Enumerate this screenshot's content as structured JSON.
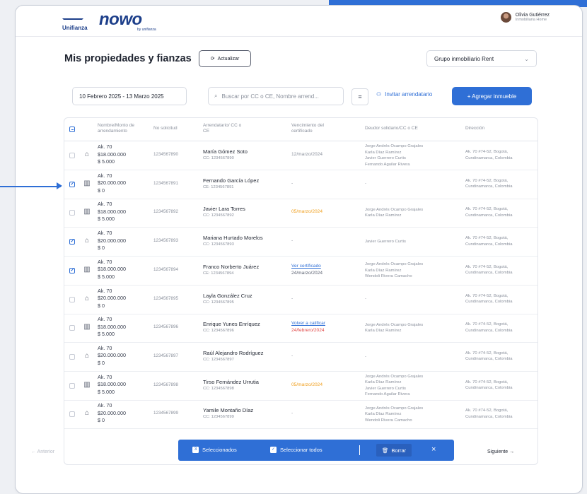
{
  "brand": {
    "partner": "Unifianza",
    "logo": "nowo",
    "logo_sub": "by unifianza"
  },
  "user": {
    "name": "Olivia Gutiérrez",
    "role": "Inmobiliaria Home"
  },
  "page_title": "Mis propiedades y fianzas",
  "refresh_label": "Actualizar",
  "group_select": {
    "value": "Grupo inmobiliario Rent"
  },
  "date_range": "10 Febrero 2025 - 13 Marzo 2025",
  "search": {
    "placeholder": "Buscar por CC o CE, Nombre arrend..."
  },
  "invite_label": "Invitar arrendatario",
  "add_label": "+ Agregar inmueble",
  "headers": {
    "property": "Nombre/Monto de arrendamiento",
    "request": "No solicitud",
    "tenant": "Arrendatario/ CC o CE",
    "cert": "Vencimiento del certificado",
    "debtor": "Deudor solidario/CC o CE",
    "address": "Dirección"
  },
  "rows": [
    {
      "checked": false,
      "icon": "house",
      "name": "Ak. 70",
      "amount": "$18.000.000",
      "extra": "$ 5.000",
      "request": "1234567890",
      "tenant": "María Gómez Soto",
      "cc": "CC: 1234567890",
      "cert1": "12/marzo/2024",
      "cert2": "",
      "certStyle": "plain",
      "debtors": [
        "Jorge Andrés Ocampo Grajales",
        "Karla Díaz Ramírez",
        "Javier Guerrero Curtis",
        "Fernando Aguilar Rivera"
      ],
      "address": [
        "Ak. 70 #74-52, Bogotá,",
        "Cundinamarca, Colombia"
      ]
    },
    {
      "checked": true,
      "icon": "building",
      "name": "Ak. 70",
      "amount": "$20.000.000",
      "extra": "$ 0",
      "request": "1234567891",
      "tenant": "Fernando García López",
      "cc": "CE: 1234567891",
      "cert1": "-",
      "cert2": "",
      "certStyle": "plain",
      "debtors": [
        "-"
      ],
      "address": [
        "Ak. 70 #74-52, Bogotá,",
        "Cundinamarca, Colombia"
      ]
    },
    {
      "checked": false,
      "icon": "building",
      "name": "Ak. 70",
      "amount": "$18.000.000",
      "extra": "$ 5.000",
      "request": "1234567892",
      "tenant": "Javier Lara Torres",
      "cc": "CC: 1234567892",
      "cert1": "05/marzo/2024",
      "cert2": "",
      "certStyle": "orange",
      "debtors": [
        "Jorge Andrés Ocampo Grajales",
        "Karla Díaz Ramírez"
      ],
      "address": [
        "Ak. 70 #74-52, Bogotá,",
        "Cundinamarca, Colombia"
      ]
    },
    {
      "checked": true,
      "icon": "house",
      "name": "Ak. 70",
      "amount": "$20.000.000",
      "extra": "$ 0",
      "request": "1234567893",
      "tenant": "Mariana Hurtado Morelos",
      "cc": "CC: 1234567893",
      "cert1": "-",
      "cert2": "",
      "certStyle": "plain",
      "debtors": [
        "Javier Guerrero Curtis"
      ],
      "address": [
        "Ak. 70 #74-52, Bogotá,",
        "Cundinamarca, Colombia"
      ]
    },
    {
      "checked": true,
      "icon": "building",
      "name": "Ak. 70",
      "amount": "$18.000.000",
      "extra": "$ 5.000",
      "request": "1234567894",
      "tenant": "Franco Norberto Juárez",
      "cc": "CE: 1234567894",
      "cert1": "Ver certificado",
      "cert2": "24/marzo/2024",
      "certStyle": "link-dark",
      "debtors": [
        "Jorge Andrés Ocampo Grajales",
        "Karla Díaz Ramírez",
        "Wendoli Rivera Camacho"
      ],
      "address": [
        "Ak. 70 #74-52, Bogotá,",
        "Cundinamarca, Colombia"
      ]
    },
    {
      "checked": false,
      "icon": "house",
      "name": "Ak. 70",
      "amount": "$20.000.000",
      "extra": "$ 0",
      "request": "1234567895",
      "tenant": "Layla González Cruz",
      "cc": "CC: 1234567895",
      "cert1": "-",
      "cert2": "",
      "certStyle": "plain",
      "debtors": [
        "-"
      ],
      "address": [
        "Ak. 70 #74-52, Bogotá,",
        "Cundinamarca, Colombia"
      ]
    },
    {
      "checked": false,
      "icon": "building",
      "name": "Ak. 70",
      "amount": "$18.000.000",
      "extra": "$ 5.000",
      "request": "1234567896",
      "tenant": "Enrique Yunes Enríquez",
      "cc": "CC: 1234567896",
      "cert1": "Volver a calificar",
      "cert2": "24/febrero/2024",
      "certStyle": "link-red",
      "debtors": [
        "Jorge Andrés Ocampo Grajales",
        "Karla Díaz Ramírez"
      ],
      "address": [
        "Ak. 70 #74-52, Bogotá,",
        "Cundinamarca, Colombia"
      ]
    },
    {
      "checked": false,
      "icon": "house",
      "name": "Ak. 70",
      "amount": "$20.000.000",
      "extra": "$ 0",
      "request": "1234567897",
      "tenant": "Raúl Alejandro Rodríguez",
      "cc": "CC: 1234567897",
      "cert1": "-",
      "cert2": "",
      "certStyle": "plain",
      "debtors": [
        "-"
      ],
      "address": [
        "Ak. 70 #74-52, Bogotá,",
        "Cundinamarca, Colombia"
      ]
    },
    {
      "checked": false,
      "icon": "building",
      "name": "Ak. 70",
      "amount": "$18.000.000",
      "extra": "$ 5.000",
      "request": "1234567898",
      "tenant": "Tirso Fernández Urrutia",
      "cc": "CC: 1234567898",
      "cert1": "05/marzo/2024",
      "cert2": "",
      "certStyle": "orange",
      "debtors": [
        "Jorge Andrés Ocampo Grajales",
        "Karla Díaz Ramírez",
        "Javier Guerrero Curtis",
        "Fernando Aguilar Rivera"
      ],
      "address": [
        "Ak. 70 #74-52, Bogotá,",
        "Cundinamarca, Colombia"
      ]
    },
    {
      "checked": false,
      "icon": "house",
      "name": "Ak. 70",
      "amount": "$20.000.000",
      "extra": "$ 0",
      "request": "1234567899",
      "tenant": "Yamile Montaño Díaz",
      "cc": "CC: 1234567899",
      "cert1": "-",
      "cert2": "",
      "certStyle": "plain",
      "debtors": [
        "Jorge Andrés Ocampo Grajales",
        "Karla Díaz Ramírez",
        "Wendoli Rivera Camacho"
      ],
      "address": [
        "Ak. 70 #74-52, Bogotá,",
        "Cundinamarca, Colombia"
      ]
    }
  ],
  "pagination": {
    "prev": "← Anterior",
    "next": "Siguiente →"
  },
  "selection_bar": {
    "selected": "Seleccionados",
    "select_all": "Seleccionar todos",
    "delete": "Borrar",
    "close": "×"
  },
  "colors": {
    "accent": "#2f6fd6",
    "brand": "#1d3f8a",
    "warning": "#f0a020",
    "danger": "#e04848"
  }
}
